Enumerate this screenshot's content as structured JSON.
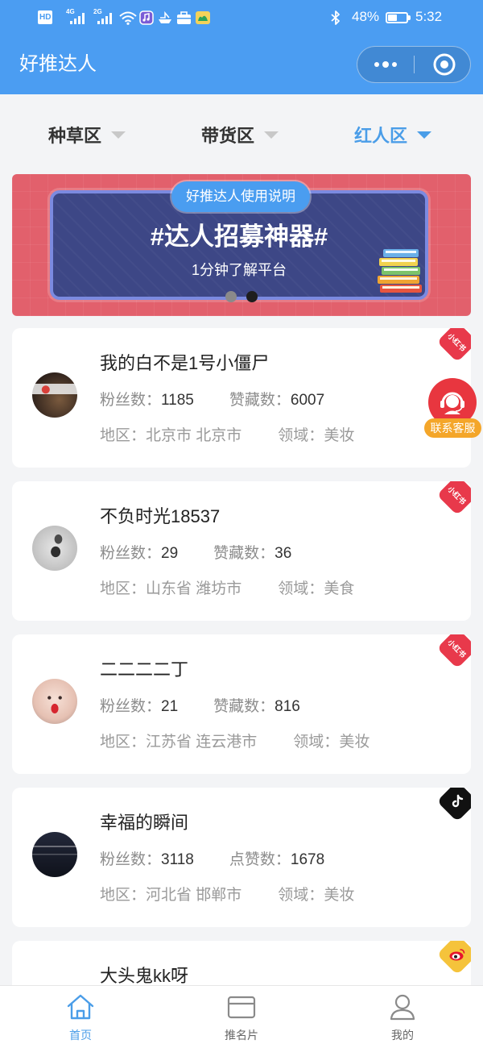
{
  "status_bar": {
    "hd": "HD",
    "network_1": "4G",
    "network_2": "2G",
    "icons_left": [
      "signal-icon",
      "signal-icon",
      "wifi-icon",
      "music-app-icon",
      "boat-app-icon",
      "briefcase-app-icon",
      "camel-app-icon"
    ],
    "icons_right": [
      "bluetooth-icon",
      "battery-icon"
    ],
    "battery_percent": "48%",
    "battery_level": 0.48,
    "time": "5:32"
  },
  "header": {
    "title": "好推达人",
    "menu_icon": "more-dots-icon",
    "exit_icon": "exit-target-icon"
  },
  "filter_tabs": [
    {
      "label": "种草区",
      "active": false
    },
    {
      "label": "带货区",
      "active": false
    },
    {
      "label": "红人区",
      "active": true
    }
  ],
  "banner": {
    "pill": "好推达人使用说明",
    "headline": "#达人招募神器#",
    "subtitle": "1分钟了解平台",
    "illustration": "books-icon",
    "carousel_dots": [
      {
        "active": false
      },
      {
        "active": true
      }
    ]
  },
  "labels": {
    "fans": "粉丝数：",
    "region": "地区：",
    "field": "领域："
  },
  "influencers": [
    {
      "name": "我的白不是1号小僵尸",
      "fans": "1185",
      "likes_label": "赞藏数：",
      "likes": "6007",
      "region": "北京市 北京市",
      "field": "美妆",
      "platform_icon": "xiaohongshu-badge-icon",
      "badge_text": "小红书"
    },
    {
      "name": "不负时光18537",
      "fans": "29",
      "likes_label": "赞藏数：",
      "likes": "36",
      "region": "山东省 潍坊市",
      "field": "美食",
      "platform_icon": "xiaohongshu-badge-icon",
      "badge_text": "小红书"
    },
    {
      "name": "二二二二丁",
      "fans": "21",
      "likes_label": "赞藏数：",
      "likes": "816",
      "region": "江苏省 连云港市",
      "field": "美妆",
      "platform_icon": "xiaohongshu-badge-icon",
      "badge_text": "小红书"
    },
    {
      "name": "幸福的瞬间",
      "fans": "3118",
      "likes_label": "点赞数：",
      "likes": "1678",
      "region": "河北省 邯郸市",
      "field": "美妆",
      "platform_icon": "douyin-badge-icon"
    },
    {
      "name": "大头鬼kk呀",
      "platform_icon": "weibo-badge-icon"
    }
  ],
  "contact_button": {
    "label": "联系客服",
    "icon": "customer-service-headset-icon"
  },
  "tab_bar": [
    {
      "label": "首页",
      "icon": "home-icon",
      "active": true
    },
    {
      "label": "推名片",
      "icon": "card-icon",
      "active": false
    },
    {
      "label": "我的",
      "icon": "user-icon",
      "active": false
    }
  ],
  "colors": {
    "brand_blue": "#4b9df2",
    "active_blue": "#4a9de8",
    "xiaohongshu_red": "#e8394b",
    "douyin_black": "#111111",
    "weibo_yellow": "#f5c33b",
    "contact_red": "#e8363f",
    "contact_label_orange": "#f4a62a",
    "banner_red": "#e2606c",
    "banner_navy": "#3d4786"
  }
}
